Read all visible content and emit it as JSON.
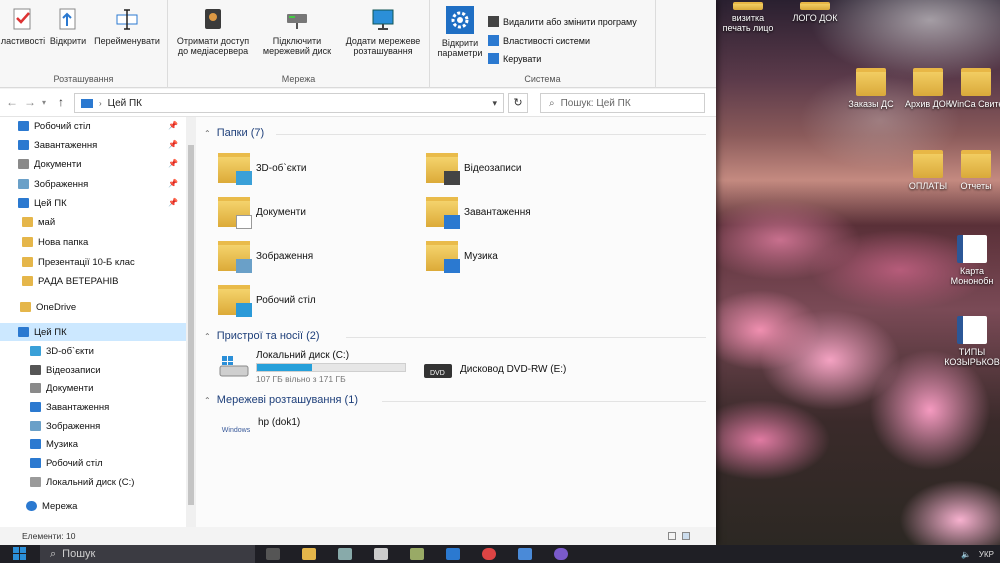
{
  "ribbon": {
    "partial_button_label": "ластивості",
    "open_label": "Відкрити",
    "rename_label": "Перейменувати",
    "location_group": "Розташування",
    "media_server_label": "Отримати доступ до медіасервера",
    "map_drive_label": "Підключити мережевий диск",
    "add_network_location_label": "Додати мережеве розташування",
    "network_group": "Мережа",
    "open_settings_label": "Відкрити параметри",
    "uninstall_label": "Видалити або змінити програму",
    "system_properties_label": "Властивості системи",
    "manage_label": "Керувати",
    "system_group": "Система"
  },
  "address": {
    "path": "Цей ПК",
    "search_placeholder": "Пошук: Цей ПК"
  },
  "sidebar": {
    "quick_access": [
      {
        "label": "Робочий стіл",
        "pinned": true,
        "icon": "desktop-icon",
        "color": "#2b79d0"
      },
      {
        "label": "Завантаження",
        "pinned": true,
        "icon": "download-icon",
        "color": "#2b79d0"
      },
      {
        "label": "Документи",
        "pinned": true,
        "icon": "documents-icon",
        "color": "#8a8a8a"
      },
      {
        "label": "Зображення",
        "pinned": true,
        "icon": "pictures-icon",
        "color": "#6aa0c8"
      },
      {
        "label": "Цей ПК",
        "pinned": true,
        "icon": "pc-icon",
        "color": "#2b79d0"
      },
      {
        "label": "май",
        "pinned": false,
        "icon": "folder-icon",
        "color": "#e5b64a"
      },
      {
        "label": "Нова папка",
        "pinned": false,
        "icon": "folder-icon",
        "color": "#e5b64a"
      },
      {
        "label": "Презентації 10-Б клас",
        "pinned": false,
        "icon": "folder-icon",
        "color": "#e5b64a"
      },
      {
        "label": "РАДА ВЕТЕРАНІВ",
        "pinned": false,
        "icon": "folder-icon",
        "color": "#e5b64a"
      }
    ],
    "onedrive": "OneDrive",
    "this_pc": "Цей ПК",
    "this_pc_children": [
      {
        "label": "3D-об`єкти",
        "icon": "3d-objects-icon",
        "color": "#3aa0d8"
      },
      {
        "label": "Відеозаписи",
        "icon": "videos-icon",
        "color": "#555"
      },
      {
        "label": "Документи",
        "icon": "documents-icon",
        "color": "#8a8a8a"
      },
      {
        "label": "Завантаження",
        "icon": "download-icon",
        "color": "#2b79d0"
      },
      {
        "label": "Зображення",
        "icon": "pictures-icon",
        "color": "#6aa0c8"
      },
      {
        "label": "Музика",
        "icon": "music-icon",
        "color": "#2b79d0"
      },
      {
        "label": "Робочий стіл",
        "icon": "desktop-icon",
        "color": "#2b79d0"
      },
      {
        "label": "Локальний диск (C:)",
        "icon": "drive-icon",
        "color": "#9a9a9a"
      }
    ],
    "network": "Мережа"
  },
  "content": {
    "folders_header": "Папки (7)",
    "folders": [
      {
        "label": "3D-об`єкти",
        "icon": "3d-objects-icon",
        "accent": "#3aa0d8"
      },
      {
        "label": "Відеозаписи",
        "icon": "videos-icon",
        "accent": "#444"
      },
      {
        "label": "Документи",
        "icon": "documents-icon",
        "accent": "#ffffff"
      },
      {
        "label": "Завантаження",
        "icon": "download-icon",
        "accent": "#2b79d0"
      },
      {
        "label": "Зображення",
        "icon": "pictures-icon",
        "accent": "#6aa0c8"
      },
      {
        "label": "Музика",
        "icon": "music-icon",
        "accent": "#2b79d0"
      },
      {
        "label": "Робочий стіл",
        "icon": "desktop-icon",
        "accent": "#2b9ad8"
      }
    ],
    "devices_header": "Пристрої та носії (2)",
    "drive_c": {
      "label": "Локальний диск (C:)",
      "free_text": "107 ГБ вільно з 171 ГБ",
      "used_fraction": 0.374
    },
    "dvd": {
      "label": "Дисковод DVD-RW (E:)",
      "badge": "DVD"
    },
    "network_header": "Мережеві розташування (1)",
    "network_item": {
      "label": "hp (dok1)",
      "logo_text": "Windows"
    }
  },
  "status": {
    "items": "Елементи: 10"
  },
  "taskbar": {
    "search": "Пошук",
    "tray_lang": "УКР"
  },
  "desktop_icons": [
    {
      "label": "визитка печать лицо",
      "type": "folder"
    },
    {
      "label": "ЛОГО ДОК",
      "type": "folder"
    },
    {
      "label": "Заказы ДС",
      "type": "folder"
    },
    {
      "label": "Архив ДОК",
      "type": "folder"
    },
    {
      "label": "WinCa Свите",
      "type": "folder"
    },
    {
      "label": "ОПЛАТЫ",
      "type": "folder"
    },
    {
      "label": "Отчеты",
      "type": "folder"
    },
    {
      "label": "Карта Мононобн",
      "type": "word"
    },
    {
      "label": "ТИПЫ КОЗЫРЬКОВ",
      "type": "word"
    }
  ],
  "colors": {
    "accent": "#0078d7",
    "selected": "#cce8ff",
    "group_header": "#1e3f7a",
    "progress": "#26a0da"
  }
}
